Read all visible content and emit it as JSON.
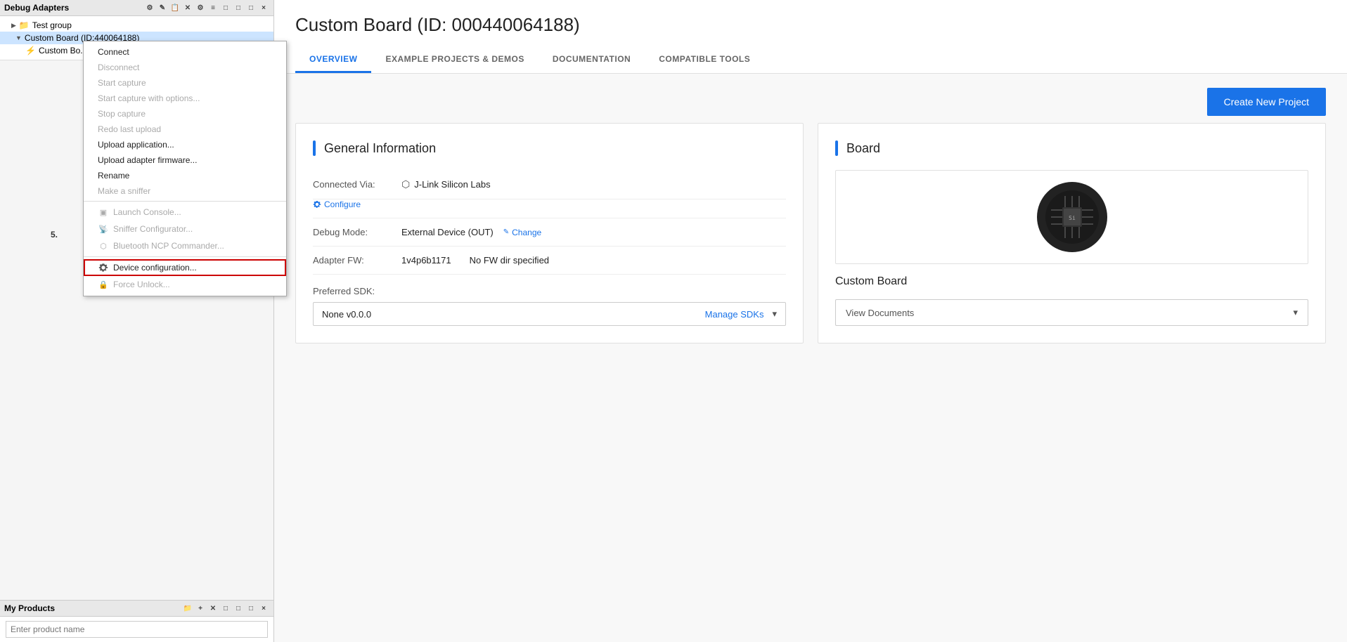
{
  "left": {
    "debug_adapters_label": "Debug Adapters",
    "toolbar_icons": [
      "×",
      "✎",
      "📋",
      "✕",
      "⚙",
      "≡",
      "□",
      "□",
      "□",
      "×"
    ],
    "tree": {
      "test_group_label": "Test group",
      "custom_board_label": "Custom Board (ID:440064188)",
      "custom_board_child_label": "Custom Bo..."
    },
    "context_menu": {
      "items": [
        {
          "label": "Connect",
          "disabled": false,
          "icon": "",
          "step": false
        },
        {
          "label": "Disconnect",
          "disabled": true,
          "icon": "",
          "step": false
        },
        {
          "label": "Start capture",
          "disabled": true,
          "icon": "",
          "step": false
        },
        {
          "label": "Start capture with options...",
          "disabled": true,
          "icon": "",
          "step": false
        },
        {
          "label": "Stop capture",
          "disabled": true,
          "icon": "",
          "step": false
        },
        {
          "label": "Redo last upload",
          "disabled": true,
          "icon": "",
          "step": false
        },
        {
          "label": "Upload application...",
          "disabled": false,
          "icon": "",
          "step": false
        },
        {
          "label": "Upload adapter firmware...",
          "disabled": false,
          "icon": "",
          "step": false
        },
        {
          "label": "Rename",
          "disabled": false,
          "icon": "",
          "step": false
        },
        {
          "label": "Make a sniffer",
          "disabled": true,
          "icon": "",
          "step": false
        },
        {
          "separator": true
        },
        {
          "label": "Launch Console...",
          "disabled": true,
          "icon": "console",
          "step": false
        },
        {
          "label": "Sniffer Configurator...",
          "disabled": true,
          "icon": "sniffer",
          "step": false
        },
        {
          "label": "Bluetooth NCP Commander...",
          "disabled": true,
          "icon": "bt",
          "step": false
        },
        {
          "separator2": true
        },
        {
          "label": "Device configuration...",
          "disabled": false,
          "icon": "gear",
          "highlighted": true,
          "step": "5."
        },
        {
          "label": "Force Unlock...",
          "disabled": true,
          "icon": "lock",
          "step": false
        }
      ]
    },
    "my_products": {
      "label": "My Products",
      "input_placeholder": "Enter product name"
    }
  },
  "right": {
    "page_title": "Custom Board (ID: 000440064188)",
    "tabs": [
      {
        "label": "OVERVIEW",
        "active": true
      },
      {
        "label": "EXAMPLE PROJECTS & DEMOS",
        "active": false
      },
      {
        "label": "DOCUMENTATION",
        "active": false
      },
      {
        "label": "COMPATIBLE TOOLS",
        "active": false
      }
    ],
    "create_new_project_label": "Create New Project",
    "general_info": {
      "title": "General Information",
      "connected_via_label": "Connected Via:",
      "connected_via_icon": "⬡",
      "connected_via_value": "J-Link Silicon Labs",
      "configure_label": "Configure",
      "debug_mode_label": "Debug Mode:",
      "debug_mode_value": "External Device (OUT)",
      "change_label": "Change",
      "adapter_fw_label": "Adapter FW:",
      "adapter_fw_value": "1v4p6b1171",
      "fw_dir_value": "No FW dir specified",
      "preferred_sdk_label": "Preferred SDK:",
      "sdk_value": "None v0.0.0",
      "manage_sdks_label": "Manage SDKs"
    },
    "board": {
      "title": "Board",
      "board_name": "Custom Board",
      "view_docs_label": "View Documents"
    }
  }
}
